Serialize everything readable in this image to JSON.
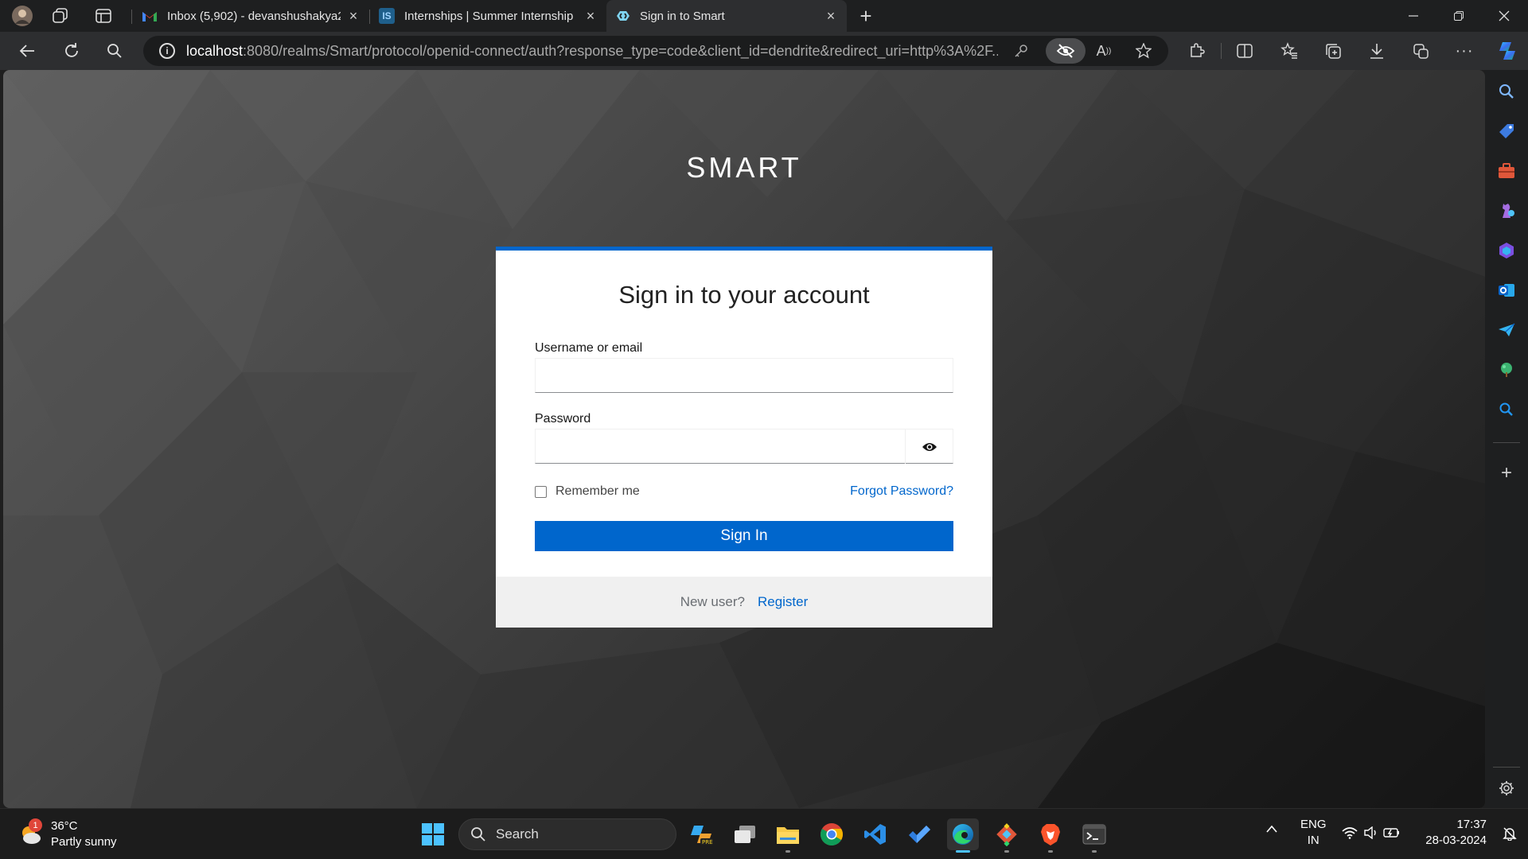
{
  "browser": {
    "tabs": [
      {
        "title": "Inbox (5,902) - devanshushakya2",
        "favicon": "gmail-icon",
        "active": false
      },
      {
        "title": "Internships | Summer Internship",
        "favicon": "internshala-icon",
        "active": false
      },
      {
        "title": "Sign in to Smart",
        "favicon": "keycloak-icon",
        "active": true
      }
    ],
    "url_host": "localhost",
    "url_rest": ":8080/realms/Smart/protocol/openid-connect/auth?response_type=code&client_id=dendrite&redirect_uri=http%3A%2F...",
    "colors": {
      "accent": "#0066cc",
      "frame": "#1e1f20",
      "toolbar": "#2d2e30"
    }
  },
  "login": {
    "brand": "SMART",
    "heading": "Sign in to your account",
    "username_label": "Username or email",
    "username_value": "",
    "password_label": "Password",
    "password_value": "",
    "remember_label": "Remember me",
    "forgot_label": "Forgot Password?",
    "signin_label": "Sign In",
    "new_user_text": "New user?",
    "register_label": "Register"
  },
  "taskbar": {
    "weather_temp": "36°C",
    "weather_desc": "Partly sunny",
    "weather_badge": "1",
    "search_label": "Search",
    "lang_line1": "ENG",
    "lang_line2": "IN",
    "time": "17:37",
    "date": "28-03-2024"
  }
}
